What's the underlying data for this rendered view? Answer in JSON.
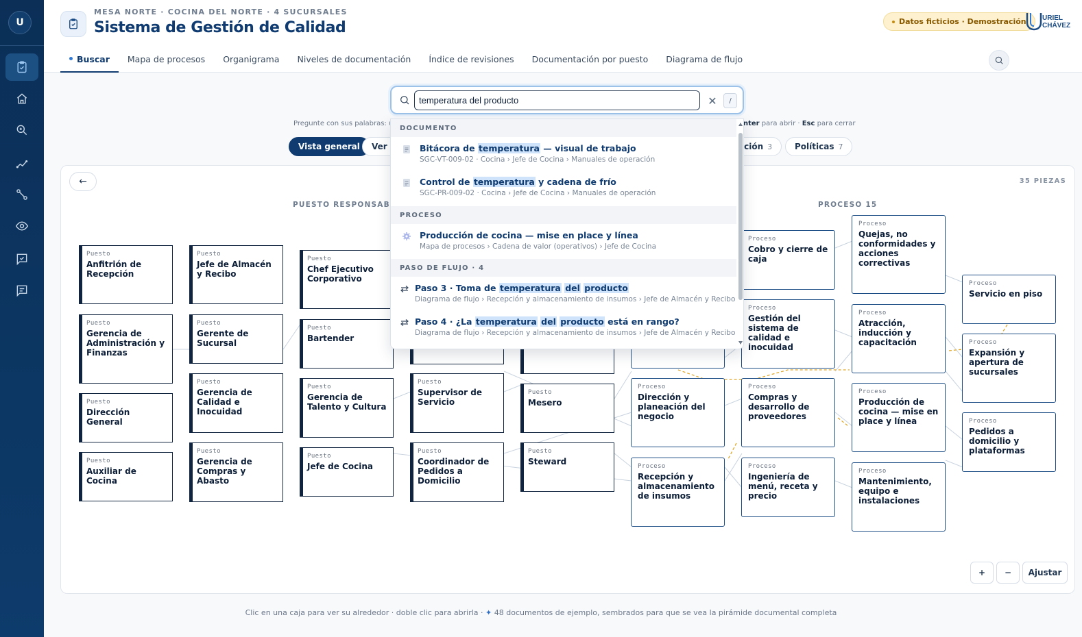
{
  "sidebar": {
    "avatar": "U",
    "items": [
      {
        "name": "calidad",
        "icon": "clipboard-check-icon",
        "active": true
      },
      {
        "name": "inicio",
        "icon": "home-icon"
      },
      {
        "name": "explorar",
        "icon": "zoom-search-icon"
      },
      {
        "name": "tendencias",
        "icon": "trend-line-icon"
      },
      {
        "name": "flujo",
        "icon": "flow-nodes-icon"
      },
      {
        "name": "vista",
        "icon": "eye-icon"
      },
      {
        "name": "revisiones",
        "icon": "check-chat-icon"
      },
      {
        "name": "mensajes",
        "icon": "message-icon"
      }
    ]
  },
  "header": {
    "eyebrow": "MESA NORTE · COCINA DEL NORTE · 4 SUCURSALES",
    "title": "Sistema de Gestión de Calidad",
    "badge": "Datos ficticios · Demostración",
    "logo_text": "URIEL CHÁVEZ",
    "tabs": [
      "Buscar",
      "Mapa de procesos",
      "Organigrama",
      "Niveles de documentación",
      "Índice de revisiones",
      "Documentación por puesto",
      "Diagrama de flujo"
    ]
  },
  "search": {
    "value": "temperatura del producto",
    "kbd": "/",
    "hint_left": "Pregunte con sus palabras: ur",
    "hint_right_enter": "nter",
    "hint_right_open": " para abrir · ",
    "hint_right_esc": "Esc",
    "hint_right_close": " para cerrar"
  },
  "filters": [
    {
      "label": "Vista general",
      "count": "",
      "active": true
    },
    {
      "label": "Ver o",
      "count": ""
    },
    {
      "label": "cción",
      "count": "3"
    },
    {
      "label": "Políticas",
      "count": "7"
    }
  ],
  "results": {
    "groups": [
      "DOCUMENTO",
      "PROCESO",
      "PASO DE FLUJO · 4"
    ],
    "items": [
      {
        "title_parts": [
          "Bitácora de ",
          "temperatura",
          " — visual de trabajo"
        ],
        "sub": "SGC-VT-009-02 · Cocina › Jefe de Cocina › Manuales de operación"
      },
      {
        "title_parts": [
          "Control de ",
          "temperatura",
          " y cadena de frío"
        ],
        "sub": "SGC-PR-009-02 · Cocina › Jefe de Cocina › Manuales de operación"
      },
      {
        "title": "Producción de cocina — mise en place y línea",
        "sub": "Mapa de procesos › Cadena de valor (operativos) › Jefe de Cocina"
      },
      {
        "title_parts": [
          "Paso 3 · Toma de ",
          "temperatura",
          " ",
          "del",
          " ",
          "producto"
        ],
        "sub": "Diagrama de flujo › Recepción y almacenamiento de insumos › Jefe de Almacén y Recibo"
      },
      {
        "title_parts": [
          "Paso 4 · ¿La ",
          "temperatura",
          " ",
          "del",
          " ",
          "producto",
          " está en rango?"
        ],
        "sub": "Diagrama de flujo › Recepción y almacenamiento de insumos › Jefe de Almacén y Recibo"
      }
    ]
  },
  "canvas": {
    "back": "←",
    "pieces": "35 PIEZAS",
    "col_puesto": "PUESTO RESPONSABLE",
    "col_proceso": "PROCESO 15",
    "puesto_kind": "Puesto",
    "proceso_kind": "Proceso",
    "puestos": [
      "Anfitrión de Recepción",
      "Jefe de Almacén y Recibo",
      "Chef Ejecutivo Corporativo",
      "Gerencia de Administración y Finanzas",
      "Gerente de Sucursal",
      "Bartender",
      "Dirección General",
      "Gerencia de Calidad e Inocuidad",
      "Gerencia de Talento y Cultura",
      "Supervisor de Servicio",
      "Mesero",
      "Auxiliar de Cocina",
      "Gerencia de Compras y Abasto",
      "Jefe de Cocina",
      "Coordinador de Pedidos a Domicilio",
      "Steward"
    ],
    "procesos": [
      "Cobro y cierre de caja",
      "Quejas, no conformidades y acciones correctivas",
      "Servicio en piso",
      "Gestión del sistema de calidad e inocuidad",
      "Atracción, inducción y capacitación",
      "Expansión y apertura de sucursales",
      "Dirección y planeación del negocio",
      "Compras y desarrollo de proveedores",
      "Producción de cocina — mise en place y línea",
      "Pedidos a domicilio y plataformas",
      "Recepción y almacenamiento de insumos",
      "Ingeniería de menú, receta y precio",
      "Mantenimiento, equipo e instalaciones"
    ],
    "zoom_in": "+",
    "zoom_out": "−",
    "fit": "Ajustar"
  },
  "footer": {
    "text_a": "Clic en una caja para ver su alrededor · doble clic para abrirla ·",
    "star": "✦",
    "text_b": "48 documentos de ejemplo, sembrados para que se vea la pirámide documental completa"
  },
  "colors": {
    "navy": "#0f3b70",
    "sidebar": "#0b2f57",
    "accent": "#2f7ad6",
    "badge_bg": "#fdf1cf",
    "highlight": "#cfe4fb"
  }
}
